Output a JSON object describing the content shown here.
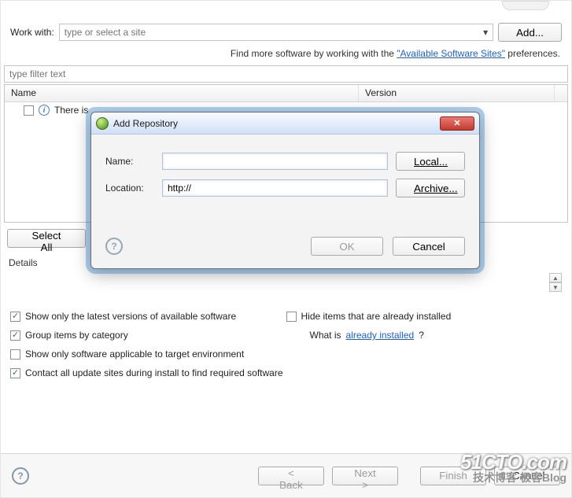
{
  "workwith": {
    "label": "Work with:",
    "placeholder": "type or select a site",
    "add_button": "Add..."
  },
  "find_line": {
    "prefix": "Find more software by working with the ",
    "link": "\"Available Software Sites\"",
    "suffix": " preferences."
  },
  "filter": {
    "placeholder": "type filter text"
  },
  "table": {
    "col_name": "Name",
    "col_version": "Version",
    "rows": [
      {
        "checked": false,
        "text": "There is"
      }
    ]
  },
  "buttons": {
    "select_all": "Select All"
  },
  "details": {
    "header": "Details"
  },
  "options": {
    "show_latest": {
      "checked": true,
      "label": "Show only the latest versions of available software"
    },
    "hide_installed": {
      "checked": false,
      "label": "Hide items that are already installed"
    },
    "group_cat": {
      "checked": true,
      "label": "Group items by category"
    },
    "whatis_prefix": "What is ",
    "whatis_link": "already installed",
    "whatis_suffix": "?",
    "target_env": {
      "checked": false,
      "label": "Show only software applicable to target environment"
    },
    "contact_sites": {
      "checked": true,
      "label": "Contact all update sites during install to find required software"
    }
  },
  "footer": {
    "back": "< Back",
    "next": "Next >",
    "finish": "Finish",
    "cancel": "Cancel"
  },
  "dialog": {
    "title": "Add Repository",
    "name_label": "Name:",
    "name_value": "",
    "local_button": "Local...",
    "location_label": "Location:",
    "location_value": "http://",
    "archive_button": "Archive...",
    "ok": "OK",
    "cancel": "Cancel"
  },
  "watermark": {
    "line1": "51CTO.com",
    "line2": "技术博客   极客Blog"
  }
}
